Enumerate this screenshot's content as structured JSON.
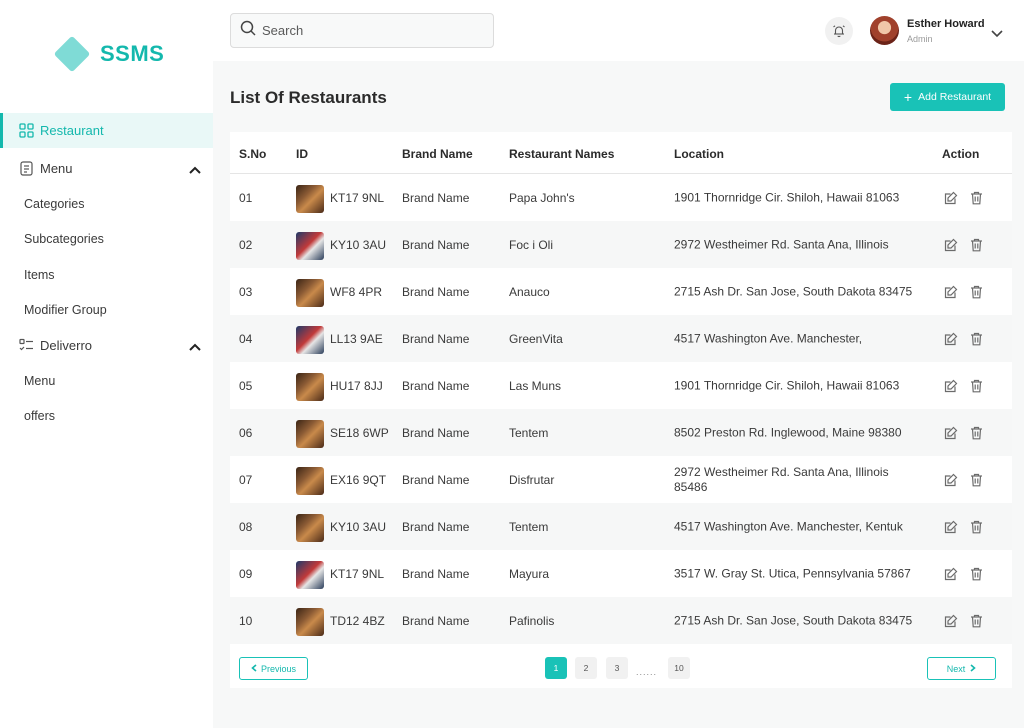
{
  "brand": {
    "name": "SSMS",
    "accent": "#19c2b7"
  },
  "sidebar": {
    "items": [
      {
        "label": "Restaurant",
        "icon": "grid-icon",
        "active": true
      },
      {
        "label": "Menu",
        "icon": "document-icon",
        "expanded": true,
        "children": [
          "Categories",
          "Subcategories",
          "Items",
          "Modifier Group"
        ]
      },
      {
        "label": "Deliverro",
        "icon": "list-check-icon",
        "expanded": true,
        "children": [
          "Menu",
          "offers"
        ]
      }
    ]
  },
  "topbar": {
    "search_placeholder": "Search",
    "user": {
      "name": "Esther Howard",
      "role": "Admin"
    }
  },
  "main": {
    "title": "List Of Restaurants",
    "add_button": "Add Restaurant"
  },
  "table": {
    "headers": [
      "S.No",
      "ID",
      "Brand Name",
      "Restaurant Names",
      "Location",
      "Action"
    ],
    "rows": [
      {
        "sno": "01",
        "id": "KT17 9NL",
        "brand": "Brand Name",
        "name": "Papa John's",
        "location": "1901 Thornridge Cir. Shiloh, Hawaii 81063",
        "thumb": "a"
      },
      {
        "sno": "02",
        "id": "KY10 3AU",
        "brand": "Brand Name",
        "name": "Foc i Oli",
        "location": "2972 Westheimer Rd. Santa Ana, Illinois",
        "thumb": "b"
      },
      {
        "sno": "03",
        "id": "WF8 4PR",
        "brand": "Brand Name",
        "name": "Anauco",
        "location": "2715 Ash Dr. San Jose, South Dakota 83475",
        "thumb": "a"
      },
      {
        "sno": "04",
        "id": "LL13 9AE",
        "brand": "Brand Name",
        "name": "GreenVita",
        "location": "4517 Washington Ave. Manchester,",
        "thumb": "b"
      },
      {
        "sno": "05",
        "id": "HU17 8JJ",
        "brand": "Brand Name",
        "name": "Las Muns",
        "location": "1901 Thornridge Cir. Shiloh, Hawaii 81063",
        "thumb": "a"
      },
      {
        "sno": "06",
        "id": "SE18 6WP",
        "brand": "Brand Name",
        "name": "Tentem",
        "location": "8502 Preston Rd. Inglewood, Maine 98380",
        "thumb": "a"
      },
      {
        "sno": "07",
        "id": "EX16 9QT",
        "brand": "Brand Name",
        "name": "Disfrutar",
        "location": "2972 Westheimer Rd. Santa Ana, Illinois 85486",
        "thumb": "a"
      },
      {
        "sno": "08",
        "id": "KY10 3AU",
        "brand": "Brand Name",
        "name": "Tentem",
        "location": "4517 Washington Ave. Manchester, Kentuk",
        "thumb": "a"
      },
      {
        "sno": "09",
        "id": "KT17 9NL",
        "brand": "Brand Name",
        "name": "Mayura",
        "location": "3517 W. Gray St. Utica, Pennsylvania 57867",
        "thumb": "b"
      },
      {
        "sno": "10",
        "id": "TD12 4BZ",
        "brand": "Brand Name",
        "name": "Pafinolis",
        "location": "2715 Ash Dr. San Jose, South Dakota 83475",
        "thumb": "a"
      }
    ]
  },
  "pagination": {
    "previous": "Previous",
    "next": "Next",
    "pages": [
      "1",
      "2",
      "3",
      "10"
    ],
    "current": "1",
    "ellipsis": "......"
  }
}
